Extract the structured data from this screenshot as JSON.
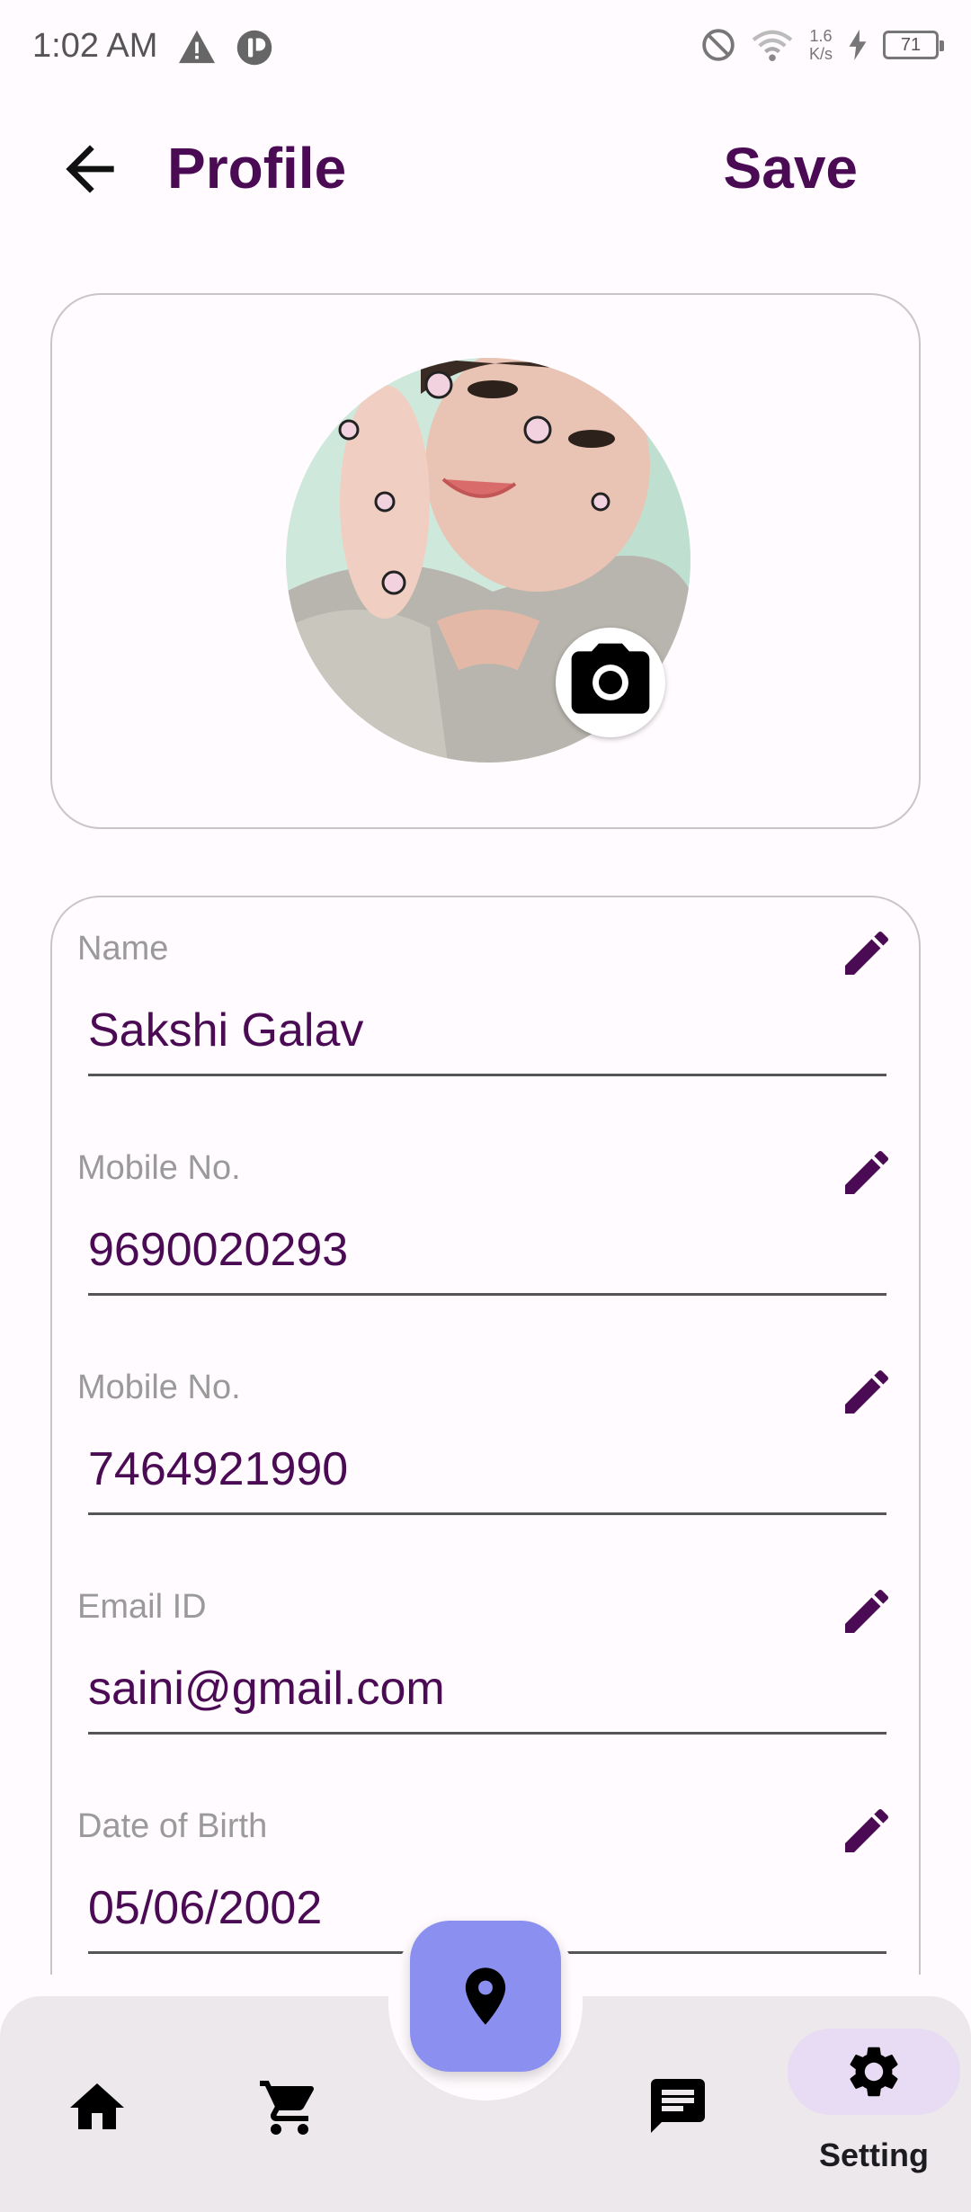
{
  "status_bar": {
    "time": "1:02 AM",
    "net_speed_value": "1.6",
    "net_speed_unit": "K/s",
    "battery_level": "71",
    "icons": [
      "warning-icon",
      "notification-app-icon",
      "do-not-disturb-icon",
      "wifi-icon",
      "charging-icon",
      "battery-icon"
    ]
  },
  "app_bar": {
    "title": "Profile",
    "save_label": "Save",
    "back_icon": "arrow-back-icon"
  },
  "avatar": {
    "camera_icon": "camera-icon"
  },
  "fields": [
    {
      "label": "Name",
      "value": "Sakshi Galav",
      "icon": "edit-icon"
    },
    {
      "label": "Mobile No.",
      "value": "9690020293",
      "icon": "edit-icon"
    },
    {
      "label": "Mobile No.",
      "value": "7464921990",
      "icon": "edit-icon"
    },
    {
      "label": "Email ID",
      "value": "saini@gmail.com",
      "icon": "edit-icon"
    },
    {
      "label": "Date of Birth",
      "value": "05/06/2002",
      "icon": "edit-icon"
    }
  ],
  "bottom_nav": {
    "items": [
      {
        "icon": "home-icon"
      },
      {
        "icon": "cart-icon"
      },
      {
        "icon": "location-pin-icon"
      },
      {
        "icon": "chat-icon"
      },
      {
        "icon": "gear-icon",
        "label": "Setting",
        "selected": true
      }
    ]
  },
  "colors": {
    "accent": "#4a0a54",
    "fab": "#8a8ff0",
    "selected_pill": "#e8dcf4",
    "nav_background": "#ece8ec"
  }
}
